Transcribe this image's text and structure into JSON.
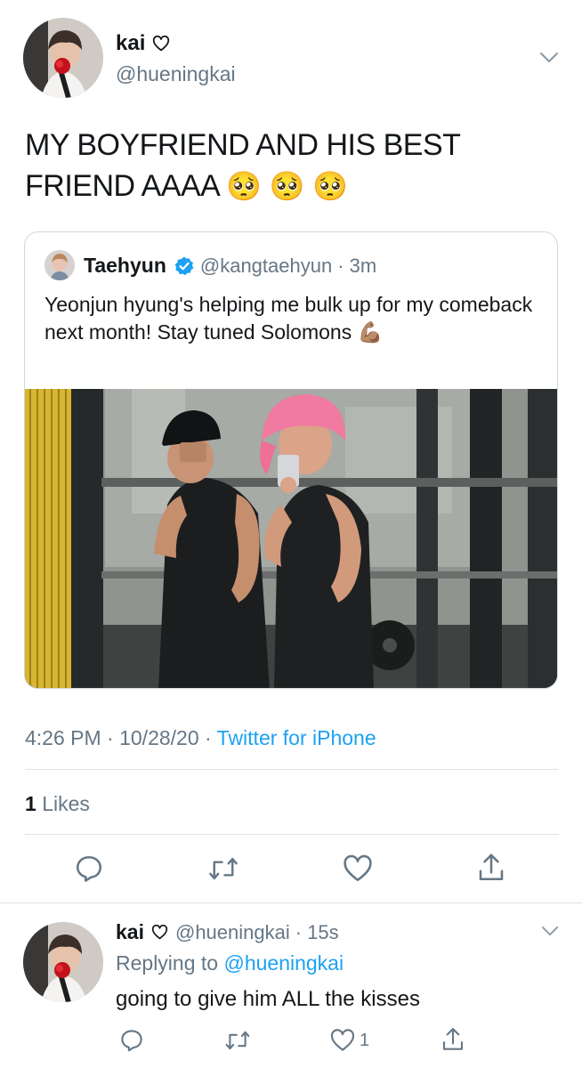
{
  "tweet": {
    "author": {
      "name": "kai",
      "name_icon": "heart-outline-icon",
      "handle": "@hueningkai"
    },
    "text": "MY BOYFRIEND AND HIS BEST FRIEND AAAA",
    "emoji": [
      "🥺",
      "🥺",
      "🥺"
    ],
    "quoted": {
      "name": "Taehyun",
      "verified_icon": "verified-badge-icon",
      "handle": "@kangtaehyun",
      "time": "· 3m",
      "text": "Yeonjun hyung's helping me bulk up for my comeback next month! Stay tuned Solomons",
      "emoji": "💪🏽",
      "media_icon": "gym-mirror-selfie-photo"
    },
    "timestamp": "4:26 PM · 10/28/20 ·",
    "source": "Twitter for iPhone",
    "likes_count": "1",
    "likes_label": "Likes",
    "actions": [
      "reply-icon",
      "retweet-icon",
      "like-icon",
      "share-icon"
    ]
  },
  "reply": {
    "name": "kai",
    "name_icon": "heart-outline-icon",
    "handle": "@hueningkai",
    "time": "· 15s",
    "replying_label": "Replying to",
    "replying_to": "@hueningkai",
    "text": "going to give him ALL the kisses",
    "like_count": "1",
    "actions": [
      "reply-icon",
      "retweet-icon",
      "like-icon",
      "share-icon"
    ]
  },
  "colors": {
    "text": "#14171a",
    "secondary": "#657786",
    "accent": "#1da1f2",
    "divider": "#dfe3e6"
  }
}
